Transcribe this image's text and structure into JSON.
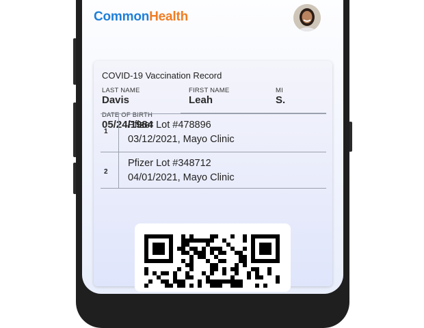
{
  "app": {
    "brand_part1": "Common",
    "brand_part2": "Health",
    "brand_colors": {
      "common": "#1f7fd8",
      "health": "#f07d22"
    },
    "avatar_icon": "user-avatar"
  },
  "record": {
    "title": "COVID-19 Vaccination Record",
    "last_name_label": "LAST NAME",
    "last_name": "Davis",
    "first_name_label": "FIRST NAME",
    "first_name": "Leah",
    "mi_label": "MI",
    "mi": "S.",
    "dob_label": "DATE OF BIRTH",
    "dob": "05/24/1984",
    "doses": [
      {
        "number": "1",
        "vaccine": "Pfizer Lot #478896",
        "details": "03/12/2021, Mayo Clinic"
      },
      {
        "number": "2",
        "vaccine": "Pfizer Lot #348712",
        "details": "04/01/2021, Mayo Clinic"
      }
    ],
    "qr_icon": "qr-code"
  }
}
